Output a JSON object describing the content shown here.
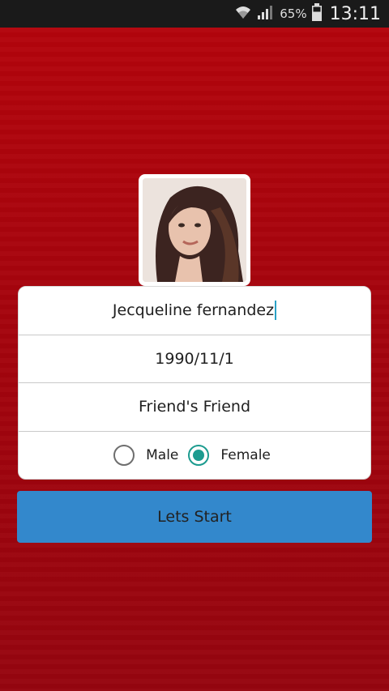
{
  "status_bar": {
    "battery_percent": "65%",
    "time": "13:11",
    "icons": [
      "wifi-icon",
      "signal-icon",
      "battery-icon"
    ]
  },
  "profile": {
    "avatar_icon": "profile-photo"
  },
  "form": {
    "name_value": "Jecqueline fernandez",
    "birthdate_value": "1990/11/1",
    "relation_value": "Friend's Friend",
    "gender": {
      "male_label": "Male",
      "female_label": "Female",
      "selected": "Female"
    }
  },
  "actions": {
    "start_label": "Lets Start"
  },
  "colors": {
    "background": "#a5040d",
    "button": "#3388cc",
    "radio_accent": "#1c9b8f",
    "caret": "#2aa1c6"
  }
}
